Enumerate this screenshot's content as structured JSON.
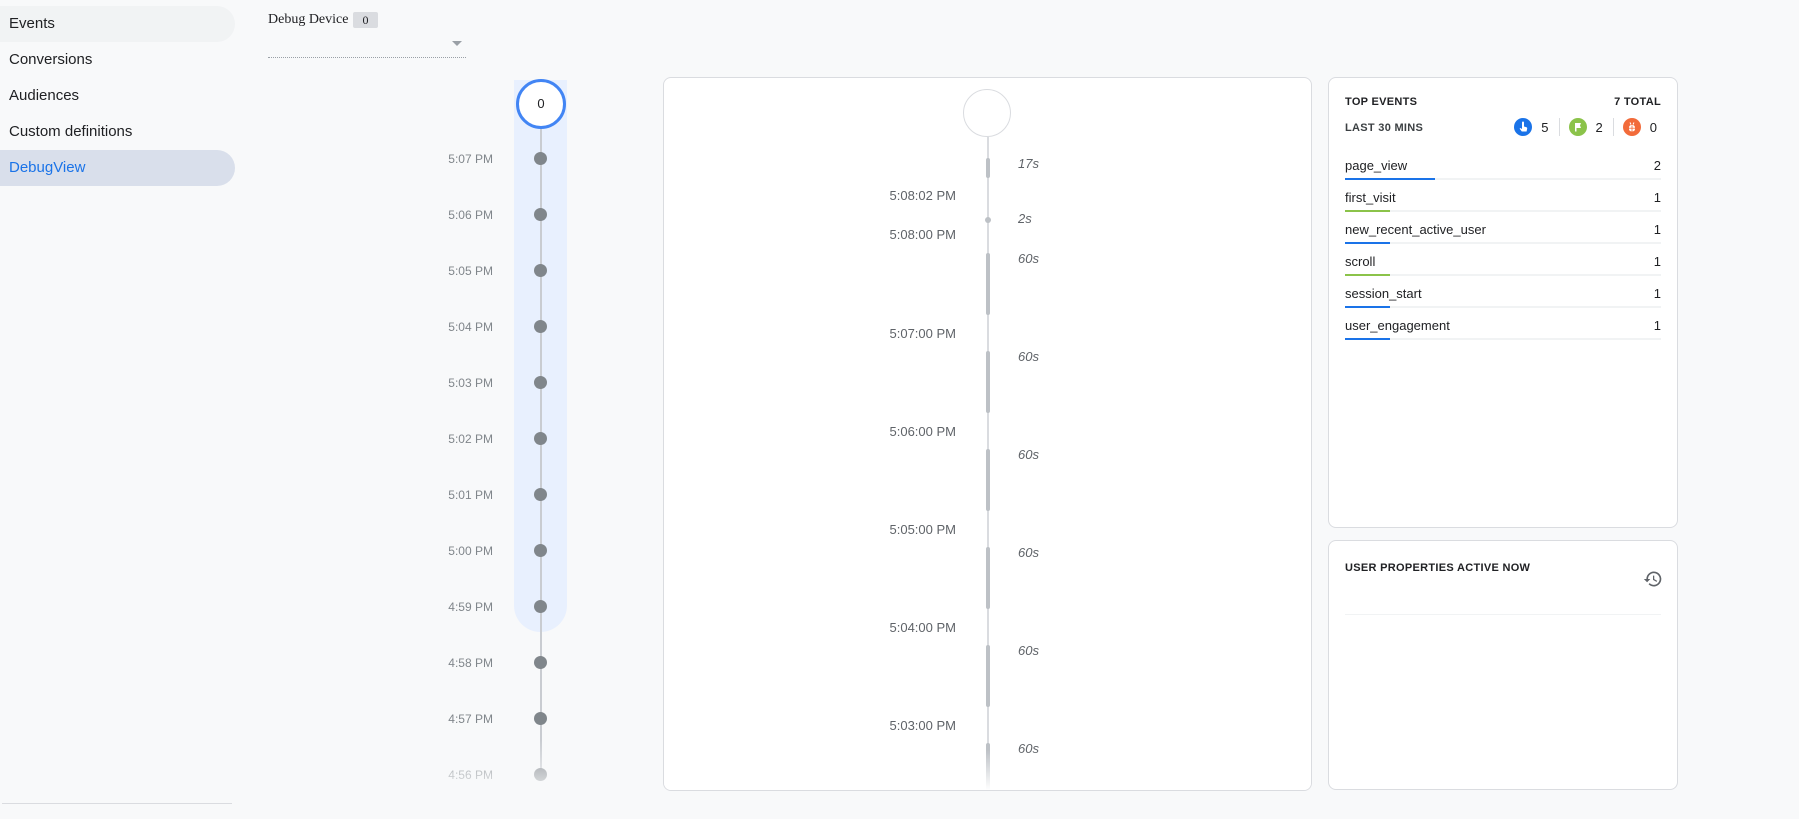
{
  "sidebar": {
    "items": [
      {
        "label": "Events",
        "state": "hover"
      },
      {
        "label": "Conversions",
        "state": ""
      },
      {
        "label": "Audiences",
        "state": ""
      },
      {
        "label": "Custom definitions",
        "state": ""
      },
      {
        "label": "DebugView",
        "state": "active"
      }
    ]
  },
  "device": {
    "label": "Debug Device",
    "count": "0",
    "selected": ""
  },
  "minutes_stream": {
    "counter": "0",
    "minutes": [
      "5:07 PM",
      "5:06 PM",
      "5:05 PM",
      "5:04 PM",
      "5:03 PM",
      "5:02 PM",
      "5:01 PM",
      "5:00 PM",
      "4:59 PM",
      "4:58 PM",
      "4:57 PM",
      "4:56 PM"
    ]
  },
  "seconds_stream": {
    "timestamps": [
      "5:08:02 PM",
      "5:08:00 PM",
      "5:07:00 PM",
      "5:06:00 PM",
      "5:05:00 PM",
      "5:04:00 PM",
      "5:03:00 PM"
    ],
    "durations": [
      "17s",
      "2s",
      "60s",
      "60s",
      "60s",
      "60s",
      "60s",
      "60s"
    ]
  },
  "top_events": {
    "title": "TOP EVENTS",
    "total": "7 TOTAL",
    "period": "LAST 30 MINS",
    "counts": [
      {
        "icon": "touch-icon",
        "value": "5",
        "color": "#1a73e8"
      },
      {
        "icon": "flag-icon",
        "value": "2",
        "color": "#8bc34a"
      },
      {
        "icon": "bug-icon",
        "value": "0",
        "color": "#f26b3a"
      }
    ],
    "events": [
      {
        "name": "page_view",
        "count": "2",
        "share": 0.2857,
        "color": "#1a73e8"
      },
      {
        "name": "first_visit",
        "count": "1",
        "share": 0.1429,
        "color": "#8bc34a"
      },
      {
        "name": "new_recent_active_user",
        "count": "1",
        "share": 0.1429,
        "color": "#1a73e8"
      },
      {
        "name": "scroll",
        "count": "1",
        "share": 0.1429,
        "color": "#8bc34a"
      },
      {
        "name": "session_start",
        "count": "1",
        "share": 0.1429,
        "color": "#1a73e8"
      },
      {
        "name": "user_engagement",
        "count": "1",
        "share": 0.1429,
        "color": "#1a73e8"
      }
    ]
  },
  "user_properties": {
    "title": "USER PROPERTIES ACTIVE NOW",
    "history_icon": "history-icon"
  }
}
